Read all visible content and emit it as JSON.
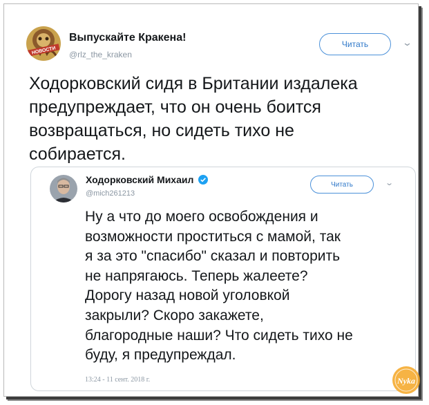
{
  "tweet": {
    "author_name": "Выпускайте Кракена!",
    "author_handle": "@rlz_the_kraken",
    "avatar_badge": "НОВОСТИ",
    "follow_label": "Читать",
    "text": "Ходорковский сидя в Британии издалека\nпредупреждает, что он очень боится\nвозвращаться, но сидеть тихо не\nсобирается."
  },
  "quoted": {
    "author_name": "Ходорковский Михаил",
    "author_handle": "@mich261213",
    "follow_label": "Читать",
    "text": "Ну а что до моего освобождения и\nвозможности проститься с мамой, так\nя за это \"спасибо\" сказал и повторить\nне напрягаюсь. Теперь жалеете?\nДорогу назад новой уголовкой\nзакрыли? Скоро закажете,\nблагородные наши? Что сидеть тихо не\nбуду, я предупреждал.",
    "timestamp": "13:24 - 11 сент. 2018 г."
  },
  "watermark": {
    "text": "Nyka"
  },
  "colors": {
    "accent": "#2f78c9",
    "verified": "#1da1f2",
    "muted": "#8a96a2",
    "watermark": "#f5a623"
  },
  "icons": {
    "chevron": "chevron-down-icon",
    "verified": "verified-badge-icon"
  }
}
